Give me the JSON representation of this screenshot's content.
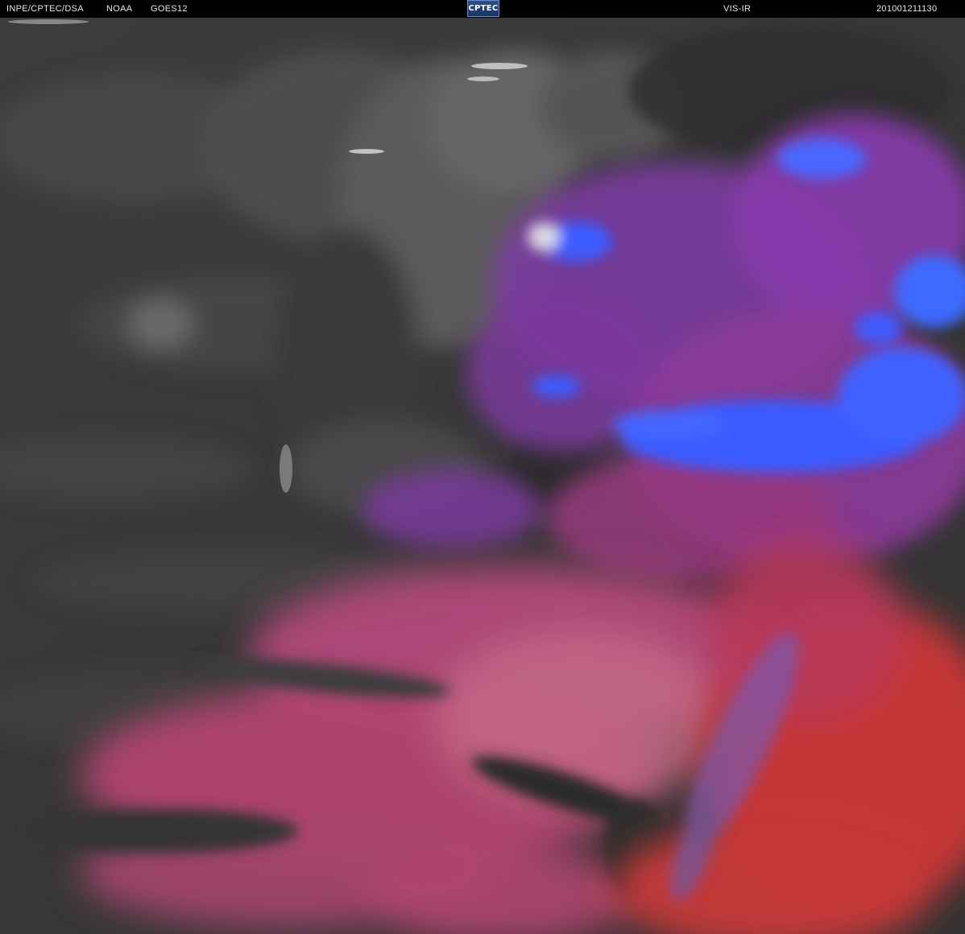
{
  "header": {
    "org": "INPE/CPTEC/DSA",
    "agency": "NOAA",
    "satellite": "GOES12",
    "logo_text": "CPTEC",
    "channel": "VIS-IR",
    "timestamp": "201001211130"
  },
  "colors": {
    "background_dark": "#3a3a3a",
    "cloud_grey": "#6a6a6a",
    "cold_cloud_blue": "#3d5cff",
    "magenta": "#8a3ca8",
    "pink": "#c24a7a",
    "red": "#cc3535"
  }
}
